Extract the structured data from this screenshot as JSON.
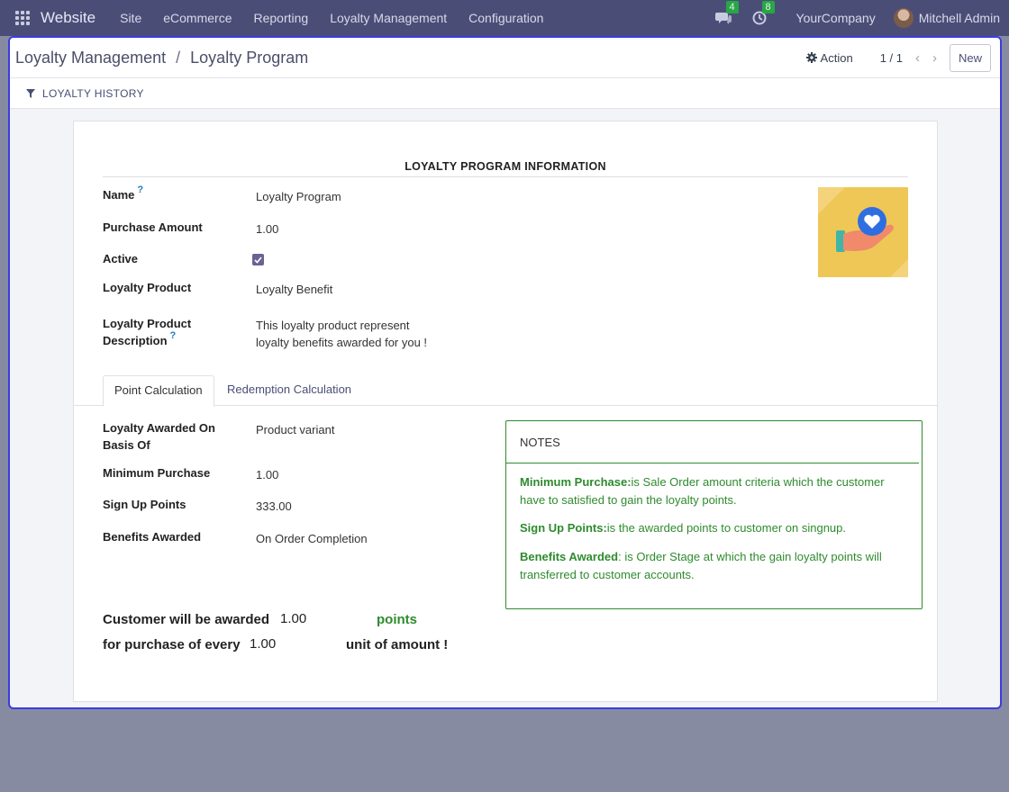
{
  "navbar": {
    "brand": "Website",
    "menu": [
      "Site",
      "eCommerce",
      "Reporting",
      "Loyalty Management",
      "Configuration"
    ],
    "messages_count": "4",
    "activities_count": "8",
    "company": "YourCompany",
    "user": "Mitchell Admin"
  },
  "control": {
    "breadcrumb_parent": "Loyalty Management",
    "breadcrumb_sep": "/",
    "breadcrumb_current": "Loyalty Program",
    "action_label": "Action",
    "pager": "1 / 1",
    "new_label": "New"
  },
  "status": {
    "history_label": "LOYALTY HISTORY"
  },
  "form": {
    "section_title": "LOYALTY PROGRAM INFORMATION",
    "name_label": "Name",
    "name_value": "Loyalty Program",
    "purchase_amount_label": "Purchase Amount",
    "purchase_amount_value": "1.00",
    "active_label": "Active",
    "active_checked": true,
    "loyalty_product_label": "Loyalty Product",
    "loyalty_product_value": "Loyalty Benefit",
    "desc_label_1": "Loyalty Product",
    "desc_label_2": "Description",
    "desc_value_1": "This loyalty product represent",
    "desc_value_2": "loyalty benefits awarded for you !",
    "help_mark": "?"
  },
  "tabs": {
    "point": "Point Calculation",
    "redemption": "Redemption Calculation"
  },
  "points": {
    "awarded_on_label_1": "Loyalty Awarded On",
    "awarded_on_label_2": "Basis Of",
    "awarded_on_value": "Product variant",
    "min_purchase_label": "Minimum Purchase",
    "min_purchase_value": "1.00",
    "signup_label": "Sign Up Points",
    "signup_value": "333.00",
    "benefits_label": "Benefits Awarded",
    "benefits_value": "On Order Completion"
  },
  "notes": {
    "title": "NOTES",
    "n1_key": "Minimum Purchase:",
    "n1_text": "is Sale Order amount criteria which the customer have to satisfied to gain the loyalty points.",
    "n2_key": "Sign Up Points:",
    "n2_text": "is the awarded points to customer on singnup.",
    "n3_key": "Benefits Awarded",
    "n3_text": ": is Order Stage at which the gain loyalty points will transferred to customer accounts."
  },
  "summary": {
    "line1_prefix": "Customer will be awarded",
    "line1_value": "1.00",
    "line1_suffix": "points",
    "line2_prefix": "for purchase of every",
    "line2_value": "1.00",
    "line2_suffix": "unit of amount !"
  },
  "colors": {
    "navbar": "#4a4e77",
    "accent": "#3a3de0",
    "notes_green": "#2e8b2e"
  }
}
